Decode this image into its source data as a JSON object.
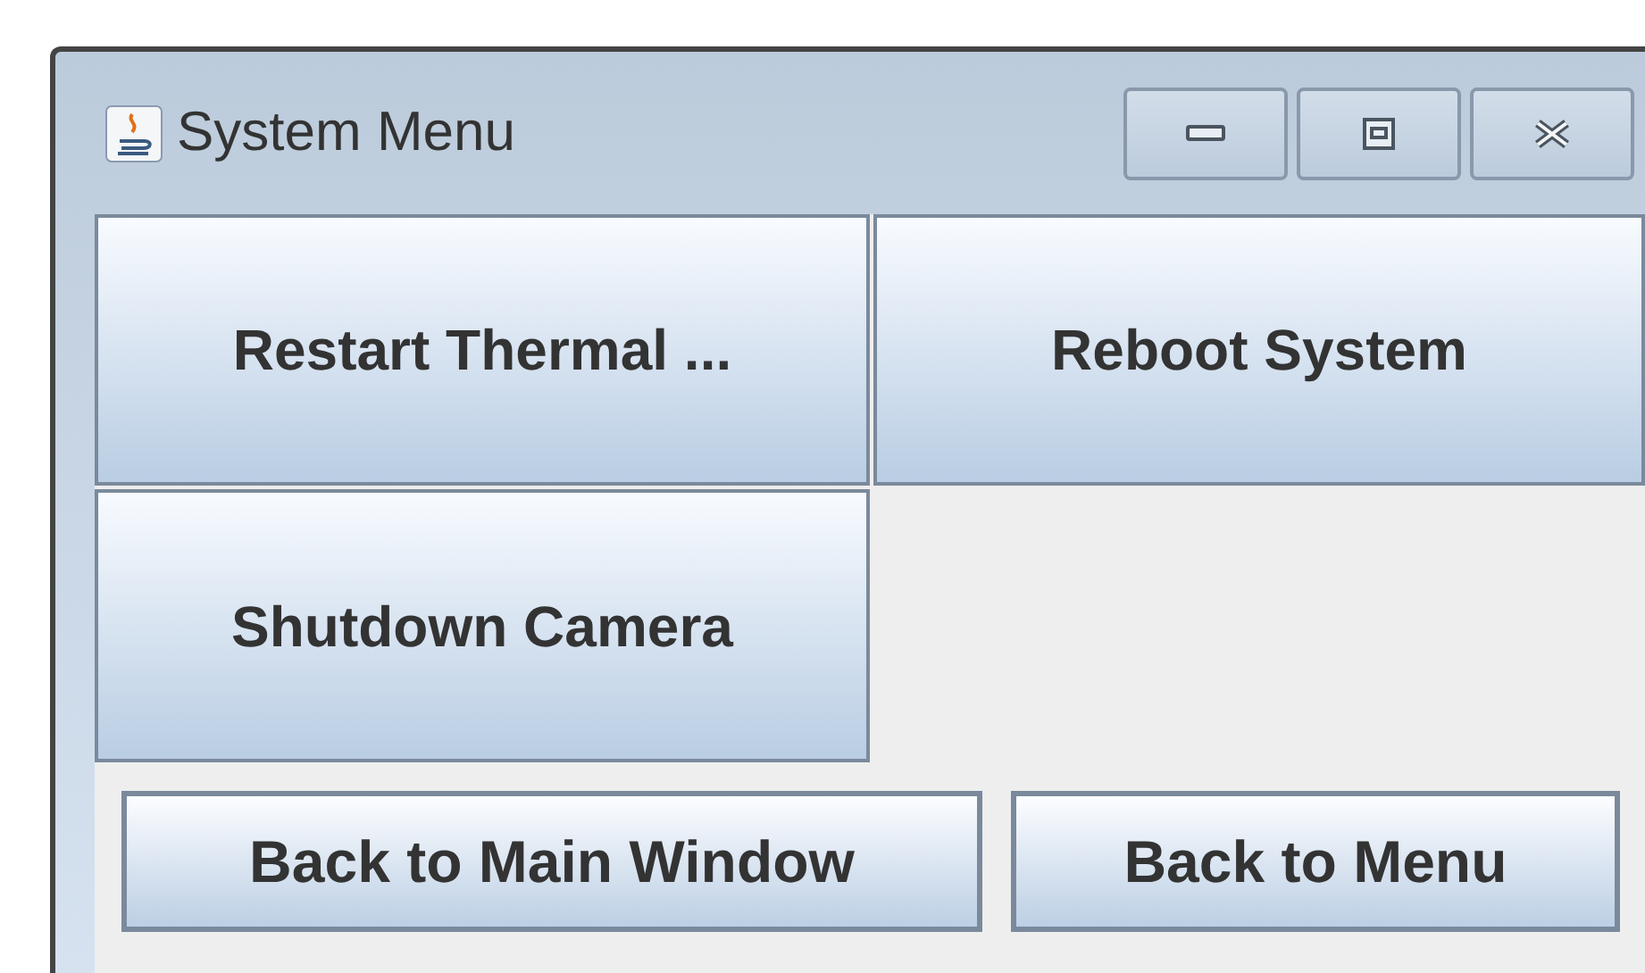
{
  "window": {
    "title": "System Menu",
    "controls": [
      {
        "kind": "minimize"
      },
      {
        "kind": "maximize"
      },
      {
        "kind": "close"
      }
    ]
  },
  "grid_buttons": [
    "Restart Thermal ...",
    "Reboot System",
    "Shutdown Camera"
  ],
  "bottom_buttons": [
    "Back to Main Window",
    "Back to Menu"
  ]
}
